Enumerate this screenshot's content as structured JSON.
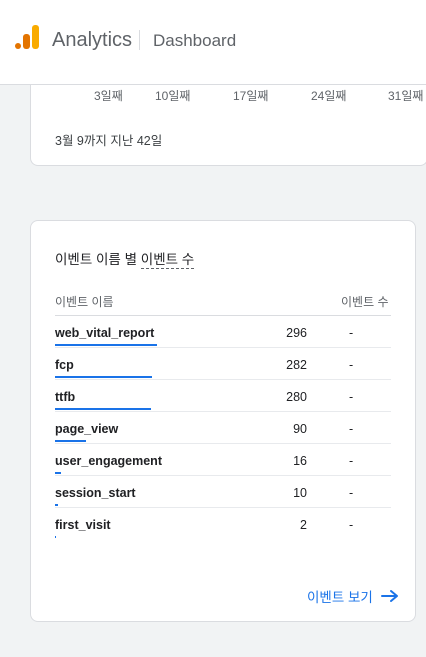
{
  "header": {
    "app_title": "Analytics",
    "page_name": "Dashboard"
  },
  "trend_card": {
    "axis_ticks": [
      "3일째",
      "10일째",
      "17일째",
      "24일째",
      "31일째"
    ],
    "summary": "3월 9까지 지난 42일"
  },
  "events_card": {
    "title_prefix": "이벤트 이름 별",
    "title_metric": "이벤트 수",
    "col_name": "이벤트 이름",
    "col_count": "이벤트 수",
    "rows": [
      {
        "name": "web_vital_report",
        "value": "296",
        "change": "-",
        "share": 1.0
      },
      {
        "name": "fcp",
        "value": "282",
        "change": "-",
        "share": 0.953
      },
      {
        "name": "ttfb",
        "value": "280",
        "change": "-",
        "share": 0.946
      },
      {
        "name": "page_view",
        "value": "90",
        "change": "-",
        "share": 0.304
      },
      {
        "name": "user_engagement",
        "value": "16",
        "change": "-",
        "share": 0.054
      },
      {
        "name": "session_start",
        "value": "10",
        "change": "-",
        "share": 0.034
      },
      {
        "name": "first_visit",
        "value": "2",
        "change": "-",
        "share": 0.007
      }
    ],
    "view_link": "이벤트 보기"
  },
  "colors": {
    "accent": "#1a73e8",
    "logo_orange": "#e37400",
    "logo_yellow": "#f9ab00"
  }
}
